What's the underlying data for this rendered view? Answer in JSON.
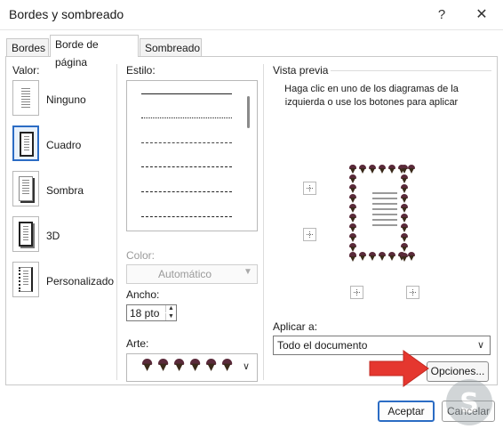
{
  "window": {
    "title": "Bordes y sombreado",
    "help_glyph": "?",
    "close_glyph": "✕"
  },
  "tabs": [
    {
      "label": "Bordes"
    },
    {
      "label": "Borde de página"
    },
    {
      "label": "Sombreado"
    }
  ],
  "settings": {
    "label": "Valor:",
    "items": [
      {
        "label": "Ninguno",
        "icon": "page-none-icon"
      },
      {
        "label": "Cuadro",
        "icon": "page-box-icon",
        "selected": true
      },
      {
        "label": "Sombra",
        "icon": "page-shadow-icon"
      },
      {
        "label": "3D",
        "icon": "page-3d-icon"
      },
      {
        "label": "Personalizado",
        "icon": "page-custom-icon"
      }
    ]
  },
  "style": {
    "label": "Estilo:",
    "lines": [
      "solid",
      "dotted",
      "dashed-fine",
      "dashed",
      "dash-dot",
      "dash-dot-dot"
    ]
  },
  "color": {
    "label": "Color:",
    "value": "Automático",
    "disabled": true
  },
  "width": {
    "label": "Ancho:",
    "value": "18 pto"
  },
  "art": {
    "label": "Arte:",
    "icon": "ice-cream-cone-icon",
    "count": 6
  },
  "preview": {
    "label": "Vista previa",
    "instructions": "Haga clic en uno de los diagramas de la izquierda o use los botones para aplicar"
  },
  "apply_to": {
    "label": "Aplicar a:",
    "value": "Todo el documento"
  },
  "buttons": {
    "options": "Opciones...",
    "ok": "Aceptar",
    "cancel": "Cancelar"
  },
  "colors": {
    "accent": "#2b6cc4",
    "arrow": "#e5372f",
    "scoop": "#5a2a3a"
  }
}
